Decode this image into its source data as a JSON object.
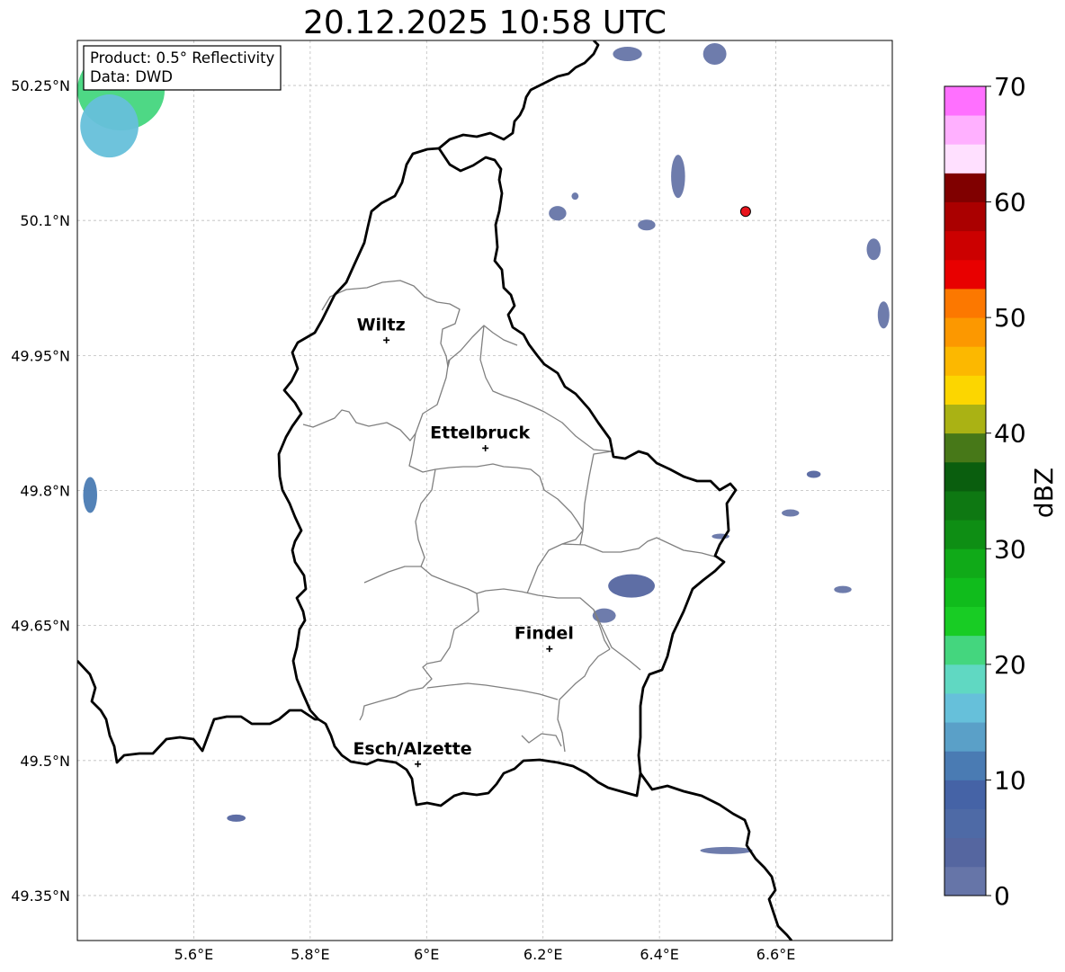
{
  "title": "20.12.2025 10:58 UTC",
  "info_box": {
    "product": "Product: 0.5° Reflectivity",
    "source": "Data: DWD"
  },
  "map": {
    "lon_range": [
      5.4,
      6.8
    ],
    "lat_range": [
      49.3,
      50.3
    ],
    "lon_ticks": [
      {
        "value": 5.6,
        "label": "5.6°E"
      },
      {
        "value": 5.8,
        "label": "5.8°E"
      },
      {
        "value": 6.0,
        "label": "6°E"
      },
      {
        "value": 6.2,
        "label": "6.2°E"
      },
      {
        "value": 6.4,
        "label": "6.4°E"
      },
      {
        "value": 6.6,
        "label": "6.6°E"
      }
    ],
    "lat_ticks": [
      {
        "value": 50.25,
        "label": "50.25°N"
      },
      {
        "value": 50.1,
        "label": "50.1°N"
      },
      {
        "value": 49.95,
        "label": "49.95°N"
      },
      {
        "value": 49.8,
        "label": "49.8°N"
      },
      {
        "value": 49.65,
        "label": "49.65°N"
      },
      {
        "value": 49.5,
        "label": "49.5°N"
      },
      {
        "value": 49.35,
        "label": "49.35°N"
      }
    ],
    "grid": true,
    "cities": [
      {
        "name": "Wiltz",
        "lon": 5.931,
        "lat": 49.967
      },
      {
        "name": "Ettelbruck",
        "lon": 6.101,
        "lat": 49.847
      },
      {
        "name": "Findel",
        "lon": 6.211,
        "lat": 49.624
      },
      {
        "name": "Esch/Alzette",
        "lon": 5.985,
        "lat": 49.496
      }
    ],
    "marker": {
      "lon": 6.548,
      "lat": 50.11,
      "color": "#e8141c"
    }
  },
  "colorbar": {
    "label": "dBZ",
    "min": 0,
    "max": 70,
    "step": 2.5,
    "tick_values": [
      0,
      10,
      20,
      30,
      40,
      50,
      60,
      70
    ],
    "tick_labels": [
      "0",
      "10",
      "20",
      "30",
      "40",
      "50",
      "60",
      "70"
    ],
    "colors": [
      "#6675a8",
      "#5566a0",
      "#4e6aa6",
      "#4563a6",
      "#4a7bb3",
      "#5aa0c8",
      "#66c0da",
      "#60d8c2",
      "#44d67e",
      "#18cc24",
      "#10bc1c",
      "#10aa18",
      "#0e8e14",
      "#0e7812",
      "#0a5e0e",
      "#477818",
      "#aab214",
      "#fcd600",
      "#fcb800",
      "#fc9800",
      "#fc7800",
      "#e80000",
      "#cc0000",
      "#aa0000",
      "#800000",
      "#ffe0ff",
      "#ffb0ff",
      "#ff70ff",
      "#ee40ee"
    ]
  },
  "reflectivity_cells": [
    {
      "lon": 6.352,
      "lat": 49.694,
      "rlon": 0.04,
      "rlat": 0.013,
      "dbz": 3
    },
    {
      "lon": 6.305,
      "lat": 49.661,
      "rlon": 0.02,
      "rlat": 0.008,
      "dbz": 2
    },
    {
      "lon": 6.432,
      "lat": 50.149,
      "rlon": 0.012,
      "rlat": 0.024,
      "dbz": 2
    },
    {
      "lon": 6.225,
      "lat": 50.108,
      "rlon": 0.015,
      "rlat": 0.008,
      "dbz": 2
    },
    {
      "lon": 6.378,
      "lat": 50.095,
      "rlon": 0.015,
      "rlat": 0.006,
      "dbz": 2
    },
    {
      "lon": 6.495,
      "lat": 50.285,
      "rlon": 0.02,
      "rlat": 0.012,
      "dbz": 2
    },
    {
      "lon": 6.345,
      "lat": 50.285,
      "rlon": 0.025,
      "rlat": 0.008,
      "dbz": 2
    },
    {
      "lon": 6.505,
      "lat": 49.749,
      "rlon": 0.015,
      "rlat": 0.003,
      "dbz": 2
    },
    {
      "lon": 6.625,
      "lat": 49.775,
      "rlon": 0.015,
      "rlat": 0.004,
      "dbz": 2
    },
    {
      "lon": 6.665,
      "lat": 49.818,
      "rlon": 0.012,
      "rlat": 0.004,
      "dbz": 3
    },
    {
      "lon": 6.715,
      "lat": 49.69,
      "rlon": 0.015,
      "rlat": 0.004,
      "dbz": 2
    },
    {
      "lon": 6.768,
      "lat": 50.068,
      "rlon": 0.012,
      "rlat": 0.012,
      "dbz": 2
    },
    {
      "lon": 6.785,
      "lat": 49.995,
      "rlon": 0.01,
      "rlat": 0.015,
      "dbz": 2
    },
    {
      "lon": 6.515,
      "lat": 49.4,
      "rlon": 0.045,
      "rlat": 0.004,
      "dbz": 2
    },
    {
      "lon": 5.673,
      "lat": 49.436,
      "rlon": 0.016,
      "rlat": 0.004,
      "dbz": 3
    },
    {
      "lon": 5.422,
      "lat": 49.795,
      "rlon": 0.012,
      "rlat": 0.02,
      "dbz": 12
    },
    {
      "lon": 5.475,
      "lat": 50.245,
      "rlon": 0.075,
      "rlat": 0.045,
      "dbz": 22
    },
    {
      "lon": 5.455,
      "lat": 50.205,
      "rlon": 0.05,
      "rlat": 0.035,
      "dbz": 15
    },
    {
      "lon": 6.255,
      "lat": 50.127,
      "rlon": 0.006,
      "rlat": 0.004,
      "dbz": 2
    }
  ]
}
